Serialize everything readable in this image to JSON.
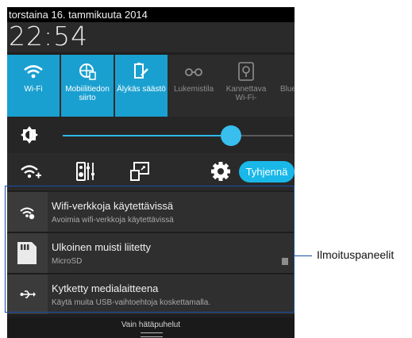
{
  "status_bar": {
    "date": "torstaina 16. tammikuuta 2014"
  },
  "clock": {
    "time": "22:54"
  },
  "quick_settings": [
    {
      "label": "Wi-Fi",
      "icon": "wifi-icon",
      "active": true
    },
    {
      "label": "Mobiilitiedon siirto",
      "icon": "mobile-data-icon",
      "active": true
    },
    {
      "label": "Älykäs säästö",
      "icon": "smart-saving-icon",
      "active": true
    },
    {
      "label": "Lukemistila",
      "icon": "reading-mode-icon",
      "active": false
    },
    {
      "label": "Kannettava Wi-Fi-",
      "icon": "portable-hotspot-icon",
      "active": false
    },
    {
      "label": "Blue",
      "icon": "bluetooth-icon",
      "active": false
    }
  ],
  "brightness": {
    "level": 0.73,
    "icon": "brightness-icon"
  },
  "tools": {
    "icons": [
      "wifi-settings-icon",
      "audio-equalizer-icon",
      "screen-cast-icon",
      "gear-icon"
    ],
    "clear_label": "Tyhjennä"
  },
  "notifications": [
    {
      "title": "Wifi-verkkoja käytettävissä",
      "text": "Avoimia wifi-verkkoja käytettävissä",
      "icon": "wifi-notification-icon"
    },
    {
      "title": "Ulkoinen muisti liitetty",
      "text": "MicroSD",
      "icon": "sd-card-icon"
    },
    {
      "title": "Kytketty medialaitteena",
      "text": "Käytä muita USB-vaihtoehtoja koskettamalla.",
      "icon": "usb-icon"
    }
  ],
  "bottom_bar": {
    "text": "Vain hätäpuhelut"
  },
  "callout": {
    "label": "Ilmoituspaneelit"
  },
  "colors": {
    "accent": "#1aa0d0",
    "frame": "#184fa8"
  }
}
